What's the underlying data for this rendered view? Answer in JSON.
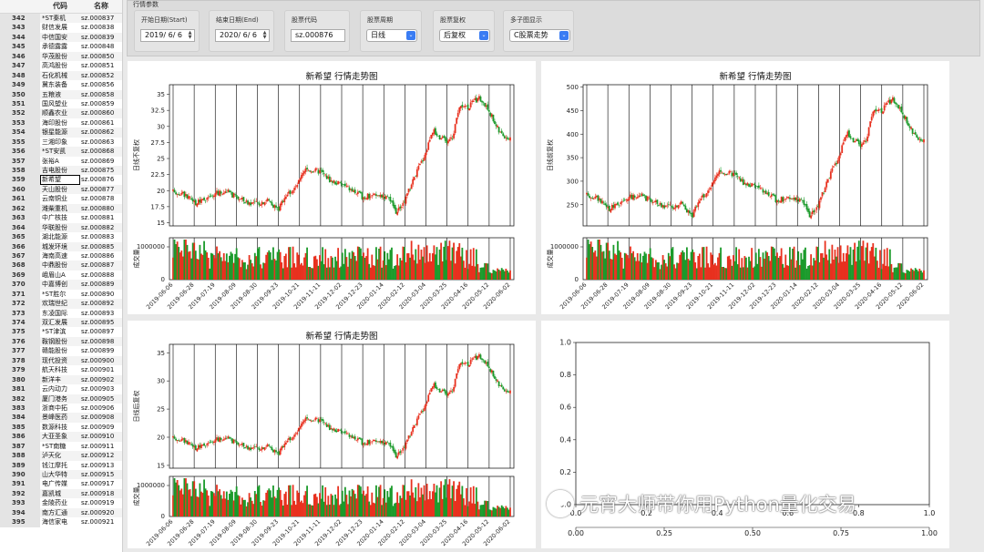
{
  "table": {
    "headers": [
      "",
      "代码",
      "名称"
    ],
    "rows": [
      [
        "342",
        "*ST秦机",
        "sz.000837"
      ],
      [
        "343",
        "财信发展",
        "sz.000838"
      ],
      [
        "344",
        "中信国安",
        "sz.000839"
      ],
      [
        "345",
        "承德露露",
        "sz.000848"
      ],
      [
        "346",
        "华茂股份",
        "sz.000850"
      ],
      [
        "347",
        "高鸿股份",
        "sz.000851"
      ],
      [
        "348",
        "石化机械",
        "sz.000852"
      ],
      [
        "349",
        "冀东装备",
        "sz.000856"
      ],
      [
        "350",
        "五粮液",
        "sz.000858"
      ],
      [
        "351",
        "国风塑业",
        "sz.000859"
      ],
      [
        "352",
        "顺鑫农业",
        "sz.000860"
      ],
      [
        "353",
        "海印股份",
        "sz.000861"
      ],
      [
        "354",
        "银星能源",
        "sz.000862"
      ],
      [
        "355",
        "三湘印象",
        "sz.000863"
      ],
      [
        "356",
        "*ST安凯",
        "sz.000868"
      ],
      [
        "357",
        "张裕A",
        "sz.000869"
      ],
      [
        "358",
        "吉电股份",
        "sz.000875"
      ],
      [
        "359",
        "新希望",
        "sz.000876"
      ],
      [
        "360",
        "天山股份",
        "sz.000877"
      ],
      [
        "361",
        "云南铜业",
        "sz.000878"
      ],
      [
        "362",
        "潍柴重机",
        "sz.000880"
      ],
      [
        "363",
        "中广核技",
        "sz.000881"
      ],
      [
        "364",
        "华联股份",
        "sz.000882"
      ],
      [
        "365",
        "湖北能源",
        "sz.000883"
      ],
      [
        "366",
        "城发环境",
        "sz.000885"
      ],
      [
        "367",
        "海南高速",
        "sz.000886"
      ],
      [
        "368",
        "中鼎股份",
        "sz.000887"
      ],
      [
        "369",
        "峨眉山A",
        "sz.000888"
      ],
      [
        "370",
        "中嘉博创",
        "sz.000889"
      ],
      [
        "371",
        "*ST胜尔",
        "sz.000890"
      ],
      [
        "372",
        "欢瑞世纪",
        "sz.000892"
      ],
      [
        "373",
        "东凌国际",
        "sz.000893"
      ],
      [
        "374",
        "双汇发展",
        "sz.000895"
      ],
      [
        "375",
        "*ST津滨",
        "sz.000897"
      ],
      [
        "376",
        "鞍钢股份",
        "sz.000898"
      ],
      [
        "377",
        "赣能股份",
        "sz.000899"
      ],
      [
        "378",
        "现代投资",
        "sz.000900"
      ],
      [
        "379",
        "航天科技",
        "sz.000901"
      ],
      [
        "380",
        "新洋丰",
        "sz.000902"
      ],
      [
        "381",
        "云内动力",
        "sz.000903"
      ],
      [
        "382",
        "厦门港务",
        "sz.000905"
      ],
      [
        "383",
        "浙商中拓",
        "sz.000906"
      ],
      [
        "384",
        "景峰医药",
        "sz.000908"
      ],
      [
        "385",
        "数源科技",
        "sz.000909"
      ],
      [
        "386",
        "大亚圣象",
        "sz.000910"
      ],
      [
        "387",
        "*ST南糖",
        "sz.000911"
      ],
      [
        "388",
        "泸天化",
        "sz.000912"
      ],
      [
        "389",
        "钱江摩托",
        "sz.000913"
      ],
      [
        "390",
        "山大华特",
        "sz.000915"
      ],
      [
        "391",
        "电广传媒",
        "sz.000917"
      ],
      [
        "392",
        "嘉凯城",
        "sz.000918"
      ],
      [
        "393",
        "金陵药业",
        "sz.000919"
      ],
      [
        "394",
        "南方汇通",
        "sz.000920"
      ],
      [
        "395",
        "海信家电",
        "sz.000921"
      ]
    ],
    "selected_index": 17
  },
  "params": {
    "title": "行情参数",
    "start_label": "开始日期(Start)",
    "start_value": "2019/ 6/ 6",
    "end_label": "结束日期(End)",
    "end_value": "2020/ 6/ 6",
    "code_label": "股票代码",
    "code_value": "sz.000876",
    "period_label": "股票周期",
    "period_value": "日线",
    "adjust_label": "股票复权",
    "adjust_value": "后复权",
    "multi_label": "多子图显示",
    "multi_value": "C股票走势"
  },
  "watermark": "元宵大师带你用Python量化交易",
  "colors": {
    "up": "#e8311f",
    "down": "#1a9a2a"
  },
  "chart_data": [
    {
      "type": "candlestick",
      "title": "新希望 行情走势图",
      "ylabel": "日线不复权",
      "ylim": [
        14.5,
        36.5
      ],
      "yticks": [
        15.0,
        17.5,
        20.0,
        22.5,
        25.0,
        27.5,
        30.0,
        32.5,
        35.0
      ],
      "vol_label": "成交量",
      "vol_ticks": [
        "1000000"
      ],
      "x_ticks": [
        "2019-06-06",
        "2019-06-28",
        "2019-07-19",
        "2019-08-09",
        "2019-08-30",
        "2019-09-23",
        "2019-10-21",
        "2019-11-11",
        "2019-12-02",
        "2019-12-23",
        "2020-01-14",
        "2020-02-12",
        "2020-03-04",
        "2020-03-25",
        "2020-04-16",
        "2020-05-12",
        "2020-06-02"
      ],
      "close_path": [
        [
          0,
          19.8
        ],
        [
          0.5,
          19.5
        ],
        [
          1,
          18.0
        ],
        [
          1.5,
          18.5
        ],
        [
          2,
          19.5
        ],
        [
          2.5,
          19.9
        ],
        [
          3,
          19.0
        ],
        [
          3.5,
          18.2
        ],
        [
          4,
          18.0
        ],
        [
          4.5,
          18.6
        ],
        [
          5,
          17.0
        ],
        [
          5.3,
          19.2
        ],
        [
          5.8,
          20.4
        ],
        [
          6.3,
          23.3
        ],
        [
          7,
          23.0
        ],
        [
          7.5,
          21.5
        ],
        [
          8,
          21.0
        ],
        [
          8.5,
          20.0
        ],
        [
          9,
          19.0
        ],
        [
          9.5,
          19.2
        ],
        [
          10,
          19.3
        ],
        [
          10.4,
          18.0
        ],
        [
          10.6,
          16.5
        ],
        [
          11,
          18.5
        ],
        [
          11.5,
          22.5
        ],
        [
          12,
          26.0
        ],
        [
          12.3,
          29.5
        ],
        [
          12.6,
          28.5
        ],
        [
          13,
          27.5
        ],
        [
          13.3,
          28.5
        ],
        [
          13.6,
          33.5
        ],
        [
          14,
          33.0
        ],
        [
          14.5,
          34.5
        ],
        [
          15,
          32.5
        ],
        [
          15.5,
          29.0
        ],
        [
          16,
          28.0
        ]
      ]
    },
    {
      "type": "candlestick",
      "title": "新希望 行情走势图",
      "ylabel": "日线前复权",
      "ylim": [
        205,
        505
      ],
      "yticks": [
        250,
        300,
        350,
        400,
        450,
        500
      ],
      "vol_label": "成交量",
      "vol_ticks": [
        "1000000"
      ],
      "x_ticks": [
        "2019-06-06",
        "2019-06-28",
        "2019-07-19",
        "2019-08-09",
        "2019-08-30",
        "2019-09-23",
        "2019-10-21",
        "2019-11-11",
        "2019-12-02",
        "2019-12-23",
        "2020-01-14",
        "2020-02-12",
        "2020-03-04",
        "2020-03-25",
        "2020-04-16",
        "2020-05-12",
        "2020-06-02"
      ],
      "close_path": [
        [
          0,
          270
        ],
        [
          0.5,
          265
        ],
        [
          1,
          240
        ],
        [
          1.5,
          250
        ],
        [
          2,
          265
        ],
        [
          2.5,
          270
        ],
        [
          3,
          260
        ],
        [
          3.5,
          250
        ],
        [
          4,
          245
        ],
        [
          4.5,
          255
        ],
        [
          5,
          225
        ],
        [
          5.3,
          260
        ],
        [
          5.8,
          280
        ],
        [
          6.3,
          320
        ],
        [
          7,
          315
        ],
        [
          7.5,
          295
        ],
        [
          8,
          290
        ],
        [
          8.5,
          275
        ],
        [
          9,
          260
        ],
        [
          9.5,
          262
        ],
        [
          10,
          265
        ],
        [
          10.4,
          245
        ],
        [
          10.6,
          225
        ],
        [
          11,
          250
        ],
        [
          11.5,
          310
        ],
        [
          12,
          355
        ],
        [
          12.3,
          405
        ],
        [
          12.6,
          390
        ],
        [
          13,
          375
        ],
        [
          13.3,
          390
        ],
        [
          13.6,
          455
        ],
        [
          14,
          450
        ],
        [
          14.5,
          475
        ],
        [
          15,
          445
        ],
        [
          15.5,
          400
        ],
        [
          16,
          385
        ]
      ]
    },
    {
      "type": "candlestick",
      "title": "新希望 行情走势图",
      "ylabel": "日线后复权",
      "ylim": [
        14.5,
        36.5
      ],
      "yticks": [
        15,
        20,
        25,
        30,
        35
      ],
      "vol_label": "成交量",
      "vol_ticks": [
        "1000000"
      ],
      "x_ticks": [
        "2019-06-06",
        "2019-06-28",
        "2019-07-19",
        "2019-08-09",
        "2019-08-30",
        "2019-09-23",
        "2019-10-21",
        "2019-11-11",
        "2019-12-02",
        "2019-12-23",
        "2020-01-14",
        "2020-02-12",
        "2020-03-04",
        "2020-03-25",
        "2020-04-16",
        "2020-05-12",
        "2020-06-02"
      ],
      "close_path": [
        [
          0,
          19.8
        ],
        [
          0.5,
          19.5
        ],
        [
          1,
          18.0
        ],
        [
          1.5,
          18.5
        ],
        [
          2,
          19.5
        ],
        [
          2.5,
          19.9
        ],
        [
          3,
          19.0
        ],
        [
          3.5,
          18.2
        ],
        [
          4,
          18.0
        ],
        [
          4.5,
          18.6
        ],
        [
          5,
          17.0
        ],
        [
          5.3,
          19.2
        ],
        [
          5.8,
          20.4
        ],
        [
          6.3,
          23.3
        ],
        [
          7,
          23.0
        ],
        [
          7.5,
          21.5
        ],
        [
          8,
          21.0
        ],
        [
          8.5,
          20.0
        ],
        [
          9,
          19.0
        ],
        [
          9.5,
          19.2
        ],
        [
          10,
          19.3
        ],
        [
          10.4,
          18.0
        ],
        [
          10.6,
          16.5
        ],
        [
          11,
          18.5
        ],
        [
          11.5,
          22.5
        ],
        [
          12,
          26.0
        ],
        [
          12.3,
          29.5
        ],
        [
          12.6,
          28.5
        ],
        [
          13,
          27.5
        ],
        [
          13.3,
          28.5
        ],
        [
          13.6,
          33.5
        ],
        [
          14,
          33.0
        ],
        [
          14.5,
          34.5
        ],
        [
          15,
          32.5
        ],
        [
          15.5,
          29.0
        ],
        [
          16,
          28.0
        ]
      ]
    },
    {
      "type": "empty",
      "title": "",
      "yticks": [
        "0.0",
        "0.2",
        "0.4",
        "0.6",
        "0.8",
        "1.0"
      ],
      "xticks": [
        "0.0",
        "0.2",
        "0.4",
        "0.6",
        "0.8",
        "1.0"
      ],
      "inner_xticks": [
        "0.00",
        "0.25",
        "0.50",
        "0.75",
        "1.00"
      ]
    }
  ]
}
